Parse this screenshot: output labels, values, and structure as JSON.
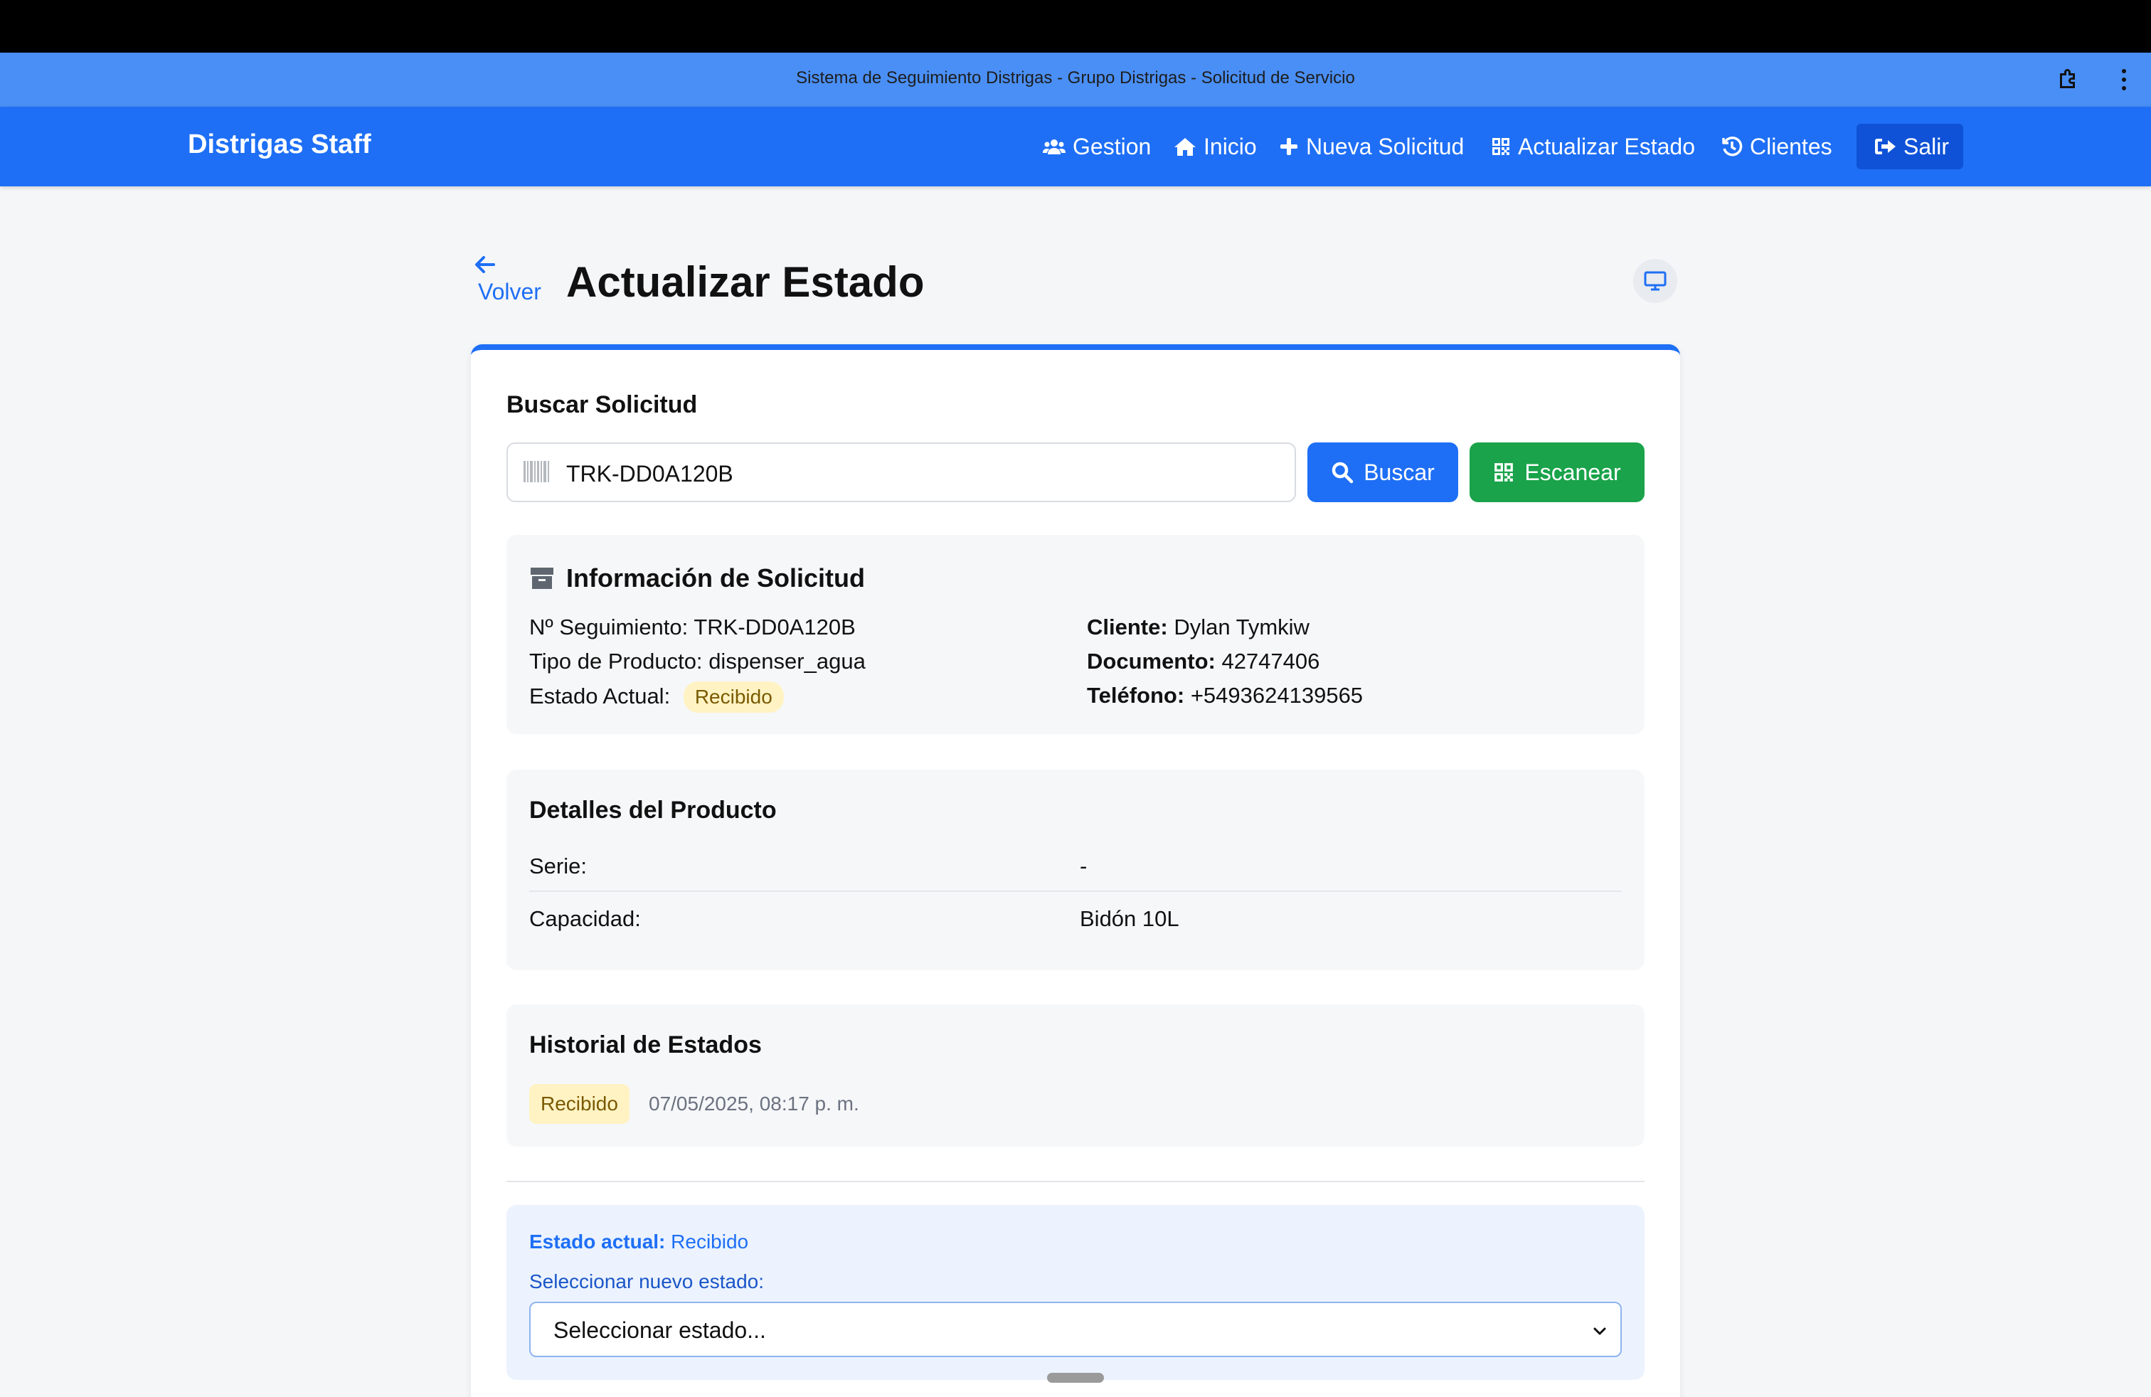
{
  "window": {
    "title": "Sistema de Seguimiento Distrigas - Grupo Distrigas - Solicitud de Servicio"
  },
  "navbar": {
    "brand": "Distrigas Staff",
    "items": [
      {
        "label": "Gestion",
        "icon": "users-icon"
      },
      {
        "label": "Inicio",
        "icon": "home-icon"
      },
      {
        "label": "Nueva Solicitud",
        "icon": "plus-icon"
      },
      {
        "label": "Actualizar Estado",
        "icon": "qrcode-icon"
      },
      {
        "label": "Clientes",
        "icon": "history-icon"
      },
      {
        "label": "Salir",
        "icon": "logout-icon"
      }
    ]
  },
  "header": {
    "back_label": "Volver",
    "title": "Actualizar Estado"
  },
  "search": {
    "heading": "Buscar Solicitud",
    "value": "TRK-DD0A120B",
    "search_button": "Buscar",
    "scan_button": "Escanear"
  },
  "info": {
    "heading": "Información de Solicitud",
    "tracking_label": "Nº Seguimiento:",
    "tracking_value": "TRK-DD0A120B",
    "product_type_label": "Tipo de Producto:",
    "product_type_value": "dispenser_agua",
    "status_label": "Estado Actual:",
    "status_value": "Recibido",
    "client_label": "Cliente:",
    "client_value": "Dylan Tymkiw",
    "document_label": "Documento:",
    "document_value": "42747406",
    "phone_label": "Teléfono:",
    "phone_value": "+5493624139565"
  },
  "details": {
    "heading": "Detalles del Producto",
    "rows": [
      {
        "label": "Serie:",
        "value": "-"
      },
      {
        "label": "Capacidad:",
        "value": "Bidón 10L"
      }
    ]
  },
  "history": {
    "heading": "Historial de Estados",
    "entries": [
      {
        "status": "Recibido",
        "timestamp": "07/05/2025, 08:17 p. m."
      }
    ]
  },
  "update": {
    "current_label": "Estado actual:",
    "current_value": "Recibido",
    "select_label": "Seleccionar nuevo estado:",
    "select_value": "Seleccionar estado..."
  },
  "colors": {
    "primary": "#1e6ff5",
    "success": "#1aa34a",
    "warning_bg": "#fff3c4"
  }
}
